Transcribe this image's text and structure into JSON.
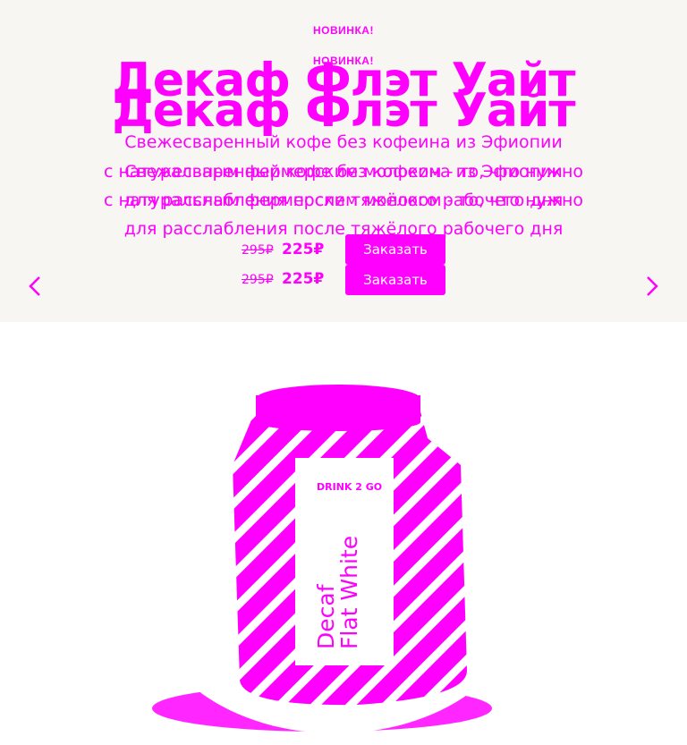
{
  "slide": {
    "badge": "НОВИНКА!",
    "title": "Декаф Флэт Уайт",
    "description_line1": "Свежесваренный кофе без кофеина из Эфиопии",
    "description_line2": "с натуральным фермерским молоком - то, что нужно",
    "description_line3": "для расслабления после тяжёлого рабочего дня",
    "description_line2_dup": "Свежесваренный кофе без кофеина из Эфиопии",
    "description_line3_dup": "для расслабления после тяжёлого рабочего дня",
    "price_old": "295₽",
    "price_new": "225₽",
    "order_label": "Заказать"
  },
  "product": {
    "brand": "DRINK 2 GO",
    "name_line1": "Decaf",
    "name_line2": "Flat White"
  },
  "nav": {
    "prev_icon": "chevron-left-icon",
    "next_icon": "chevron-right-icon"
  },
  "colors": {
    "accent": "#ff00ff",
    "hero_bg": "#f8f6f3"
  }
}
